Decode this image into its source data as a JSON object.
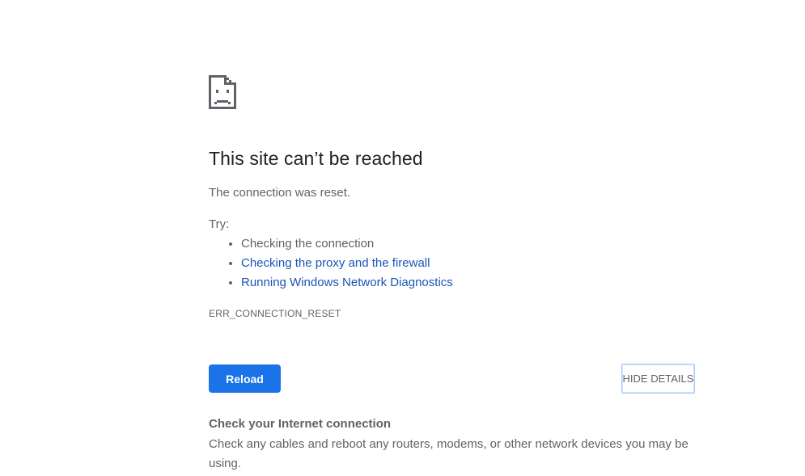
{
  "icon": "sad-page-icon",
  "main": {
    "title": "This site can’t be reached",
    "summary": "The connection was reset.",
    "try_label": "Try:",
    "suggestions": [
      {
        "label": "Checking the connection",
        "is_link": false
      },
      {
        "label": "Checking the proxy and the firewall",
        "is_link": true
      },
      {
        "label": "Running Windows Network Diagnostics",
        "is_link": true
      }
    ],
    "error_code": "ERR_CONNECTION_RESET"
  },
  "buttons": {
    "reload_label": "Reload",
    "details_label": "HIDE DETAILS"
  },
  "details": {
    "heading": "Check your Internet connection",
    "text": "Check any cables and reboot any routers, modems, or other network devices you may be using."
  },
  "colors": {
    "accent": "#1a73e8",
    "link": "#1a55b6",
    "title": "#202124",
    "body_text": "#5f6368"
  }
}
